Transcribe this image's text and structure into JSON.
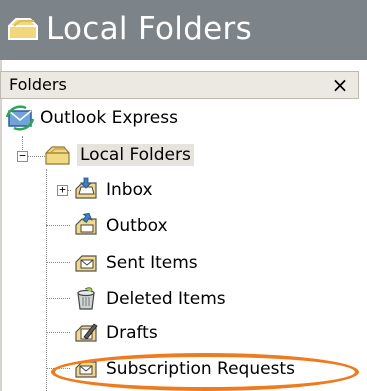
{
  "window": {
    "title": "Local Folders",
    "title_icon": "folder-icon"
  },
  "panel": {
    "header": "Folders",
    "close_label": "×"
  },
  "tree": {
    "root": {
      "label": "Outlook Express",
      "icon": "outlook-express-icon"
    },
    "local_folders": {
      "label": "Local Folders",
      "icon": "folder-icon",
      "expanded": true,
      "selected": true
    },
    "items": [
      {
        "label": "Inbox",
        "icon": "inbox-icon",
        "expandable": true
      },
      {
        "label": "Outbox",
        "icon": "outbox-icon"
      },
      {
        "label": "Sent Items",
        "icon": "sent-items-icon"
      },
      {
        "label": "Deleted Items",
        "icon": "deleted-items-icon"
      },
      {
        "label": "Drafts",
        "icon": "drafts-icon"
      },
      {
        "label": "Subscription Requests",
        "icon": "subscription-folder-icon",
        "highlighted": true
      }
    ]
  },
  "colors": {
    "titlebar": "#7c8389",
    "highlight": "#ef7b1f"
  }
}
